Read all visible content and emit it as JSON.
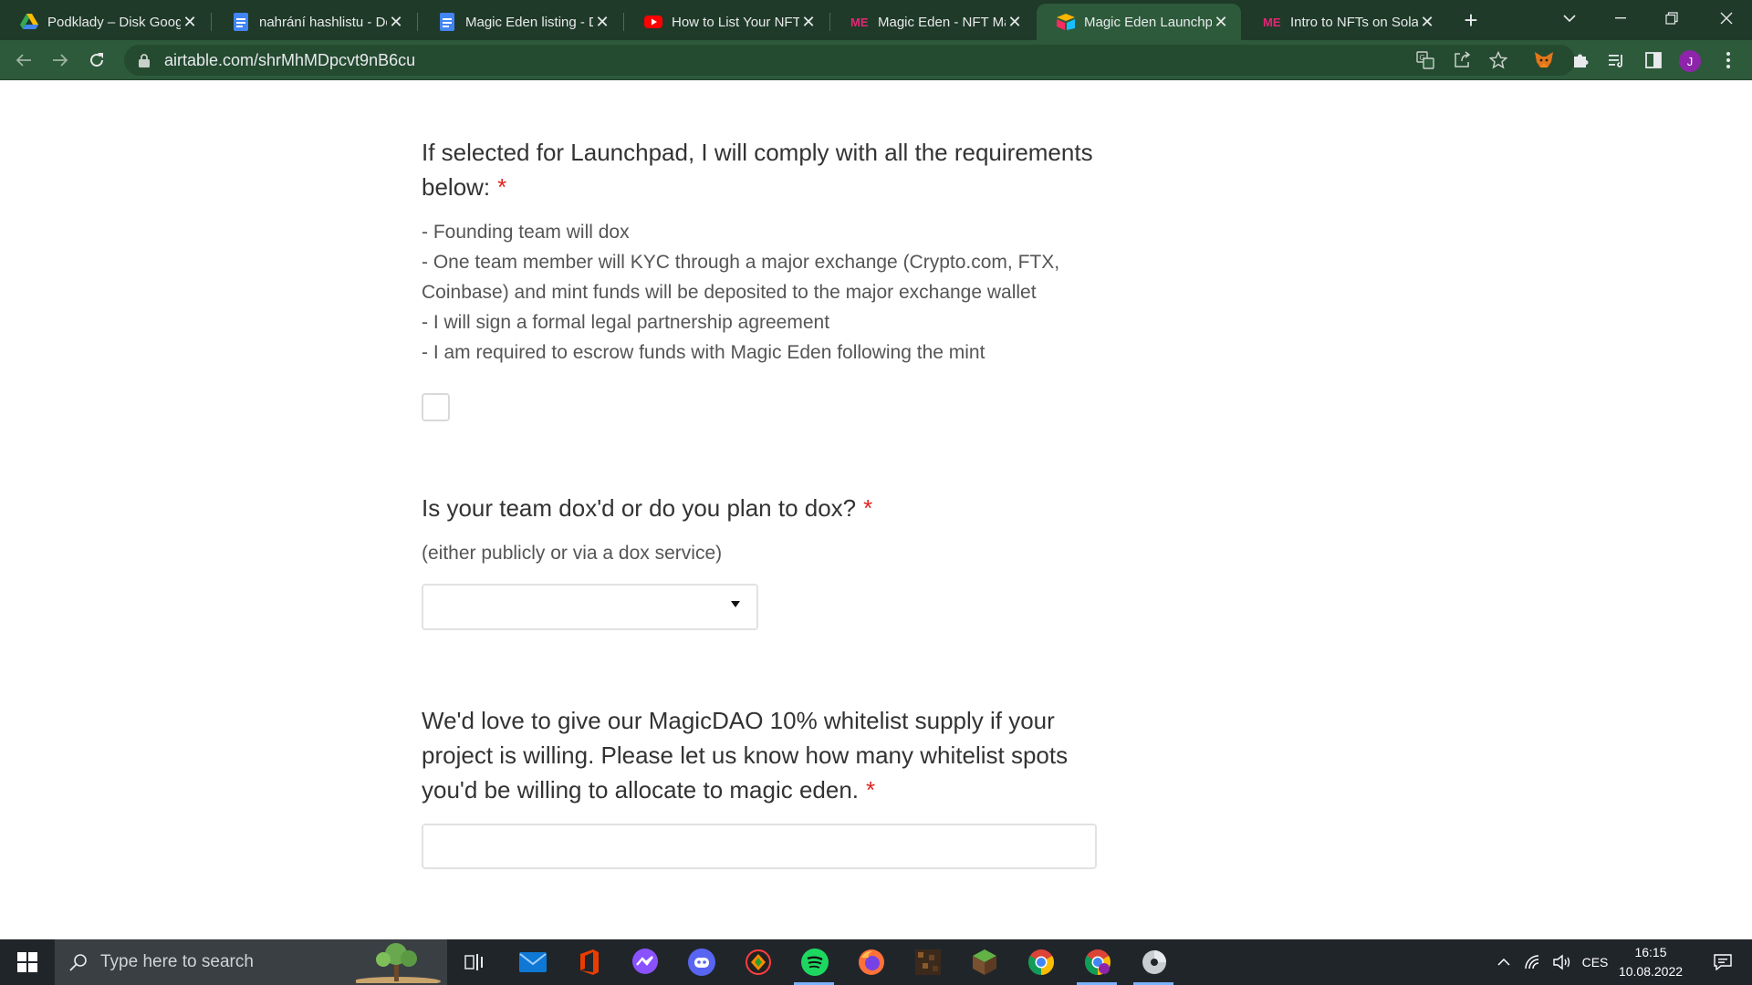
{
  "browser": {
    "tabs": [
      {
        "title": "Podklady – Disk Goog",
        "icon": "google-drive-icon"
      },
      {
        "title": "nahrání hashlistu - Do",
        "icon": "google-docs-icon"
      },
      {
        "title": "Magic Eden listing - D",
        "icon": "google-docs-icon"
      },
      {
        "title": "How to List Your NFT",
        "icon": "youtube-icon"
      },
      {
        "title": "Magic Eden - NFT Ma",
        "icon": "magic-eden-icon"
      },
      {
        "title": "Magic Eden Launchpa",
        "icon": "airtable-icon",
        "active": true
      },
      {
        "title": "Intro to NFTs on Solar",
        "icon": "magic-eden-icon"
      }
    ],
    "url": "airtable.com/shrMhMDpcvt9nB6cu",
    "profile_initial": "J"
  },
  "form": {
    "q1": {
      "label": "If selected for Launchpad, I will comply with all the requirements below:",
      "required_mark": "*",
      "desc_lines": [
        "- Founding team will dox",
        "- One team member will KYC through a major exchange (Crypto.com, FTX,",
        "Coinbase) and mint funds will be deposited to the major exchange wallet",
        "- I will sign a formal legal partnership agreement",
        "- I am required to escrow funds with Magic Eden following the mint"
      ],
      "checked": false
    },
    "q2": {
      "label": "Is your team dox'd or do you plan to dox?",
      "required_mark": "*",
      "desc": "(either publicly or via a dox service)",
      "selected_value": ""
    },
    "q3": {
      "label": "We'd love to give our MagicDAO 10% whitelist supply if your project is willing. Please let us know how many whitelist spots you'd be willing to allocate to magic eden.",
      "required_mark": "*",
      "value": ""
    }
  },
  "taskbar": {
    "search_placeholder": "Type here to search",
    "pinned": [
      "task-view-icon",
      "mail-icon",
      "office-icon",
      "messenger-icon",
      "discord-icon",
      "brave-icon",
      "spotify-icon",
      "firefox-icon",
      "minecraft-icon",
      "minecraft-launcher-icon",
      "chrome-icon",
      "chrome-profile-icon",
      "disk-icon"
    ],
    "language": "CES",
    "time": "16:15",
    "date": "10.08.2022"
  },
  "colors": {
    "chrome_frame": "#1f3a28",
    "chrome_toolbar": "#2d5a3a",
    "required": "#e02424",
    "text": "#333333"
  }
}
